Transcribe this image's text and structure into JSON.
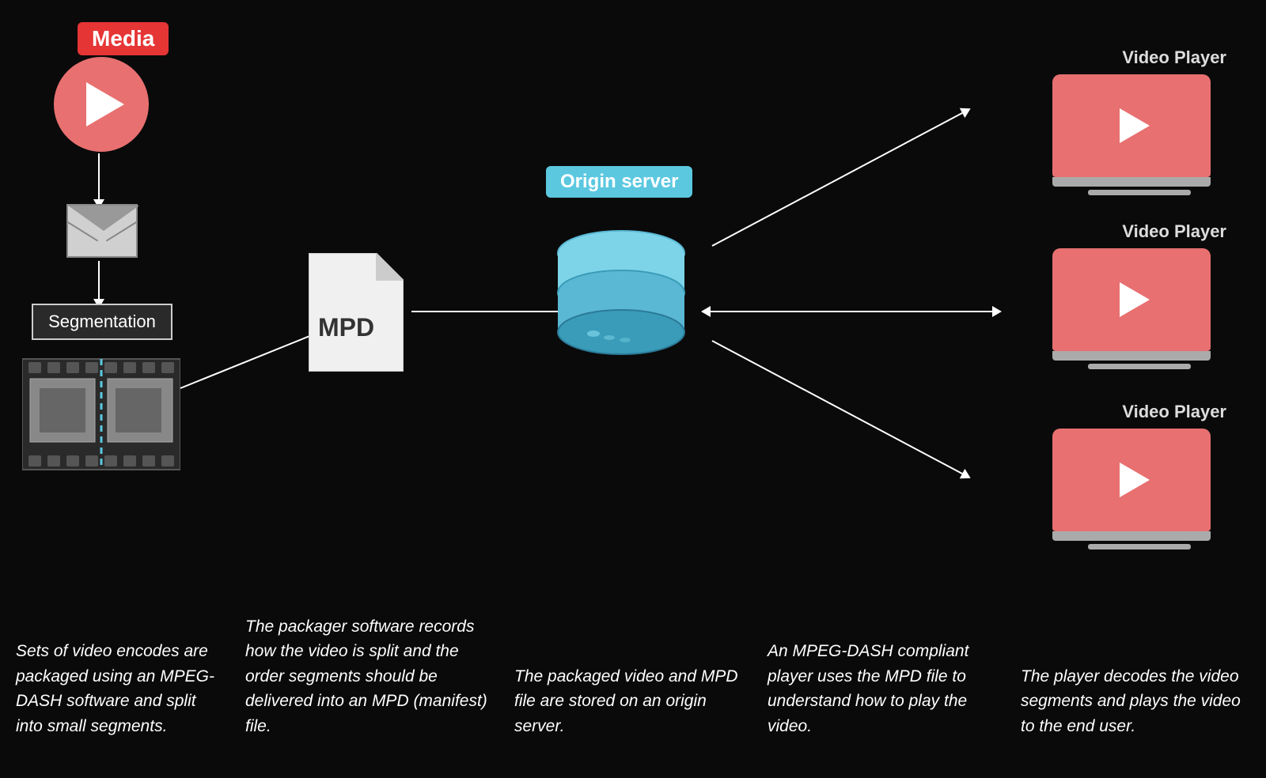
{
  "background": "#0a0a0a",
  "media": {
    "label": "Media",
    "label_bg": "#e63535"
  },
  "segmentation": {
    "label": "Segmentation"
  },
  "mpd": {
    "label": "MPD"
  },
  "origin": {
    "label": "Origin server",
    "label_bg": "#5bc8e0"
  },
  "players": [
    {
      "title": "Video Player"
    },
    {
      "title": "Video Player"
    },
    {
      "title": "Video Player"
    }
  ],
  "descriptions": [
    {
      "text": "Sets of video encodes are packaged using an MPEG-DASH software and split into small segments."
    },
    {
      "text": "The packager software records how the video is split and the order segments should be delivered into an MPD (manifest) file."
    },
    {
      "text": "The packaged video and MPD file are stored on an origin server."
    },
    {
      "text": "An MPEG-DASH compliant player uses the MPD file to understand how to play the video."
    },
    {
      "text": "The player decodes the video segments and plays the video to the end user."
    }
  ]
}
